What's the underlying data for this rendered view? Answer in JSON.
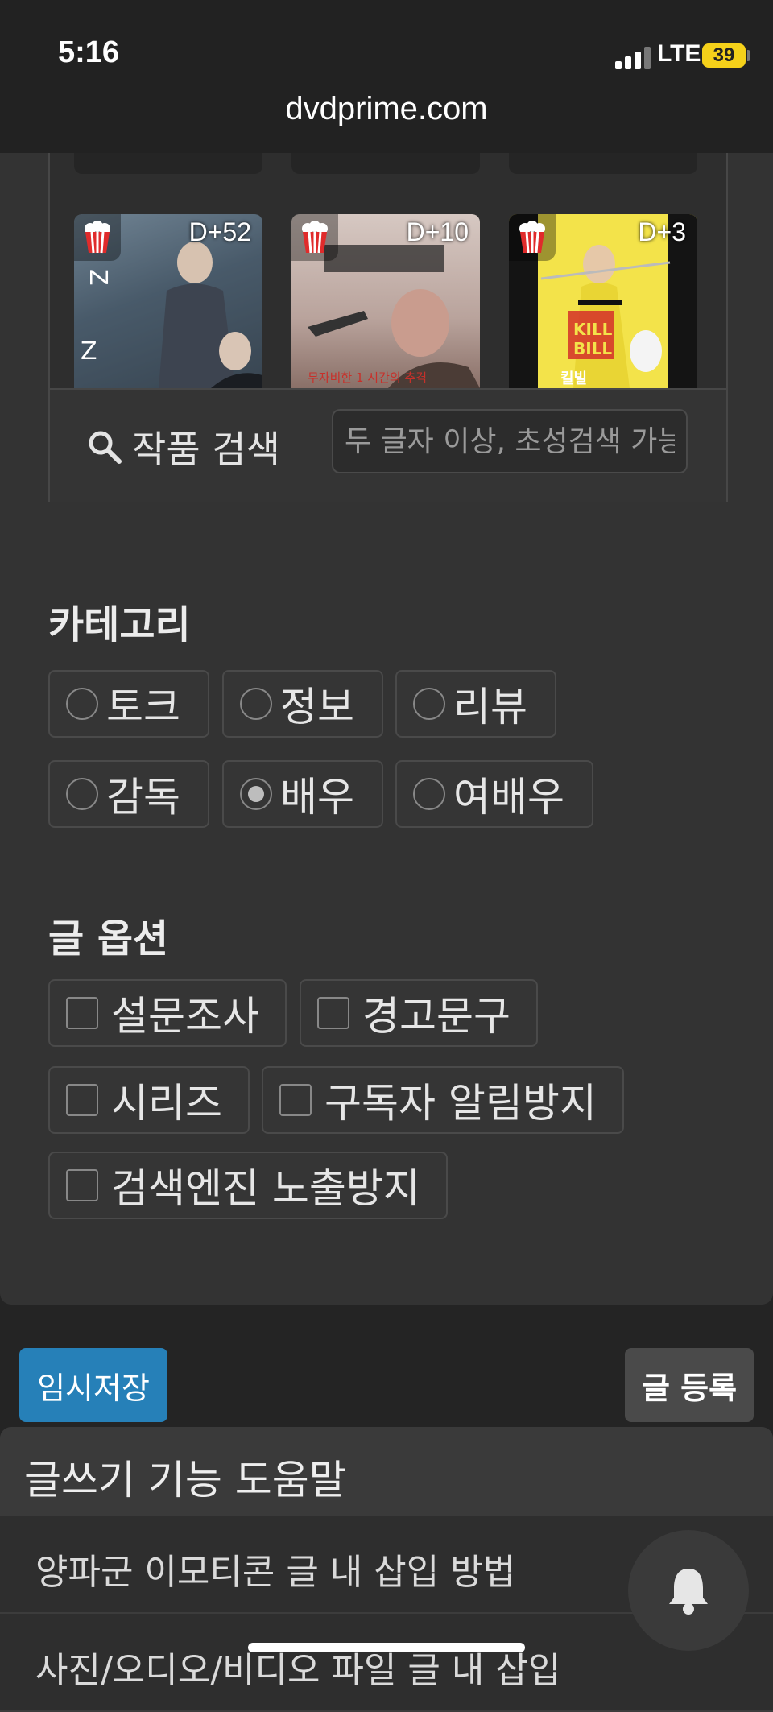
{
  "status_bar": {
    "time": "5:16",
    "network": "LTE",
    "battery": "39"
  },
  "browser": {
    "url": "dvdprime.com"
  },
  "movies": [
    {
      "dday": "D+52",
      "colors": [
        "#3a4a5a",
        "#1e2630"
      ]
    },
    {
      "dday": "D+10",
      "colors": [
        "#c9b9b3",
        "#8a7068"
      ]
    },
    {
      "dday": "D+3",
      "colors": [
        "#f3e34a",
        "#111111"
      ]
    }
  ],
  "search": {
    "label": "작품 검색",
    "placeholder": "두 글자 이상, 초성검색 가능"
  },
  "category": {
    "title": "카테고리",
    "options": [
      "토크",
      "정보",
      "리뷰",
      "감독",
      "배우",
      "여배우"
    ],
    "selected": "배우"
  },
  "post_options": {
    "title": "글 옵션",
    "options": [
      "설문조사",
      "경고문구",
      "시리즈",
      "구독자 알림방지",
      "검색엔진 노출방지"
    ]
  },
  "buttons": {
    "temp_save": "임시저장",
    "submit": "글 등록"
  },
  "help": {
    "title": "글쓰기 기능 도움말",
    "items": [
      "양파군 이모티콘 글 내 삽입 방법",
      "사진/오디오/비디오 파일 글 내 삽입"
    ]
  },
  "colors": {
    "accent": "#2680b8",
    "background": "#242424",
    "panel": "#333333"
  }
}
